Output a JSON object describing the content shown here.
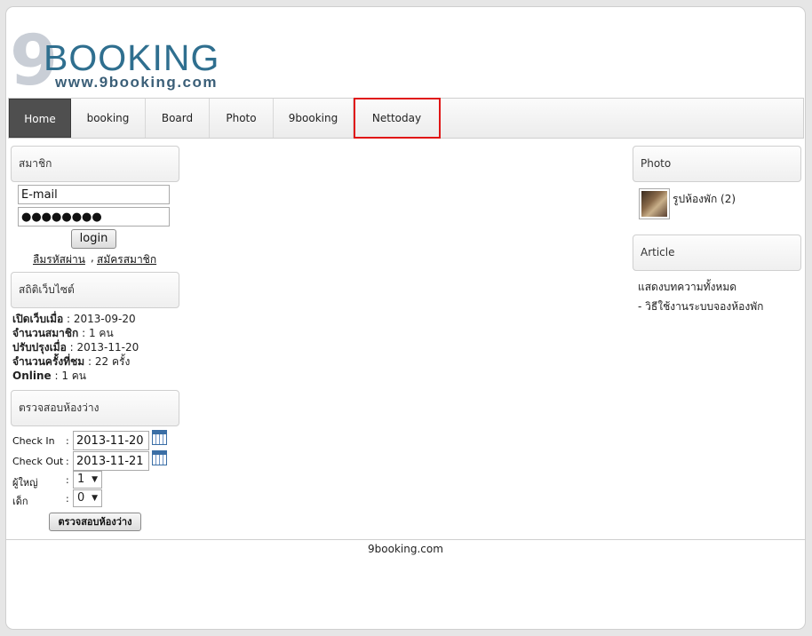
{
  "logo": {
    "nine": "9",
    "brand": "BOOKING",
    "url": "www.9booking.com"
  },
  "nav": [
    {
      "label": "Home"
    },
    {
      "label": "booking"
    },
    {
      "label": "Board"
    },
    {
      "label": "Photo"
    },
    {
      "label": "9booking"
    },
    {
      "label": "Nettoday"
    }
  ],
  "member": {
    "title": "สมาชิก",
    "email_value": "E-mail",
    "password_value": "●●●●●●●●",
    "login_label": "login",
    "forgot_link": "ลืมรหัสผ่าน",
    "separator": ",",
    "register_link": "สมัครสมาชิก"
  },
  "stats": {
    "title": "สถิติเว็บไซต์",
    "rows": [
      {
        "label": "เปิดเว็บเมื่อ",
        "value": "2013-09-20"
      },
      {
        "label": "จำนวนสมาชิก",
        "value": "1 คน"
      },
      {
        "label": "ปรับปรุงเมื่อ",
        "value": "2013-11-20"
      },
      {
        "label": "จำนวนครั้งที่ชม",
        "value": "22 ครั้ง"
      },
      {
        "label": "Online",
        "value": "1 คน"
      }
    ]
  },
  "availability": {
    "title": "ตรวจสอบห้องว่าง",
    "checkin_label": "Check In",
    "checkin_value": "2013-11-20",
    "checkout_label": "Check Out",
    "checkout_value": "2013-11-21",
    "adults_label": "ผู้ใหญ่",
    "adults_value": "1",
    "children_label": "เด็ก",
    "children_value": "0",
    "colon": ":",
    "submit_label": "ตรวจสอบห้องว่าง"
  },
  "photo": {
    "title": "Photo",
    "album_label": "รูปห้องพัก (2)"
  },
  "article": {
    "title": "Article",
    "show_all": "แสดงบทความทั้งหมด",
    "items": [
      "- วิธีใช้งานระบบจองห้องพัก"
    ]
  },
  "footer": {
    "text": "9booking.com"
  },
  "colors": {
    "nav_active": "#4f4f4f",
    "highlight": "#e01616",
    "brand": "#2f6f8f"
  }
}
